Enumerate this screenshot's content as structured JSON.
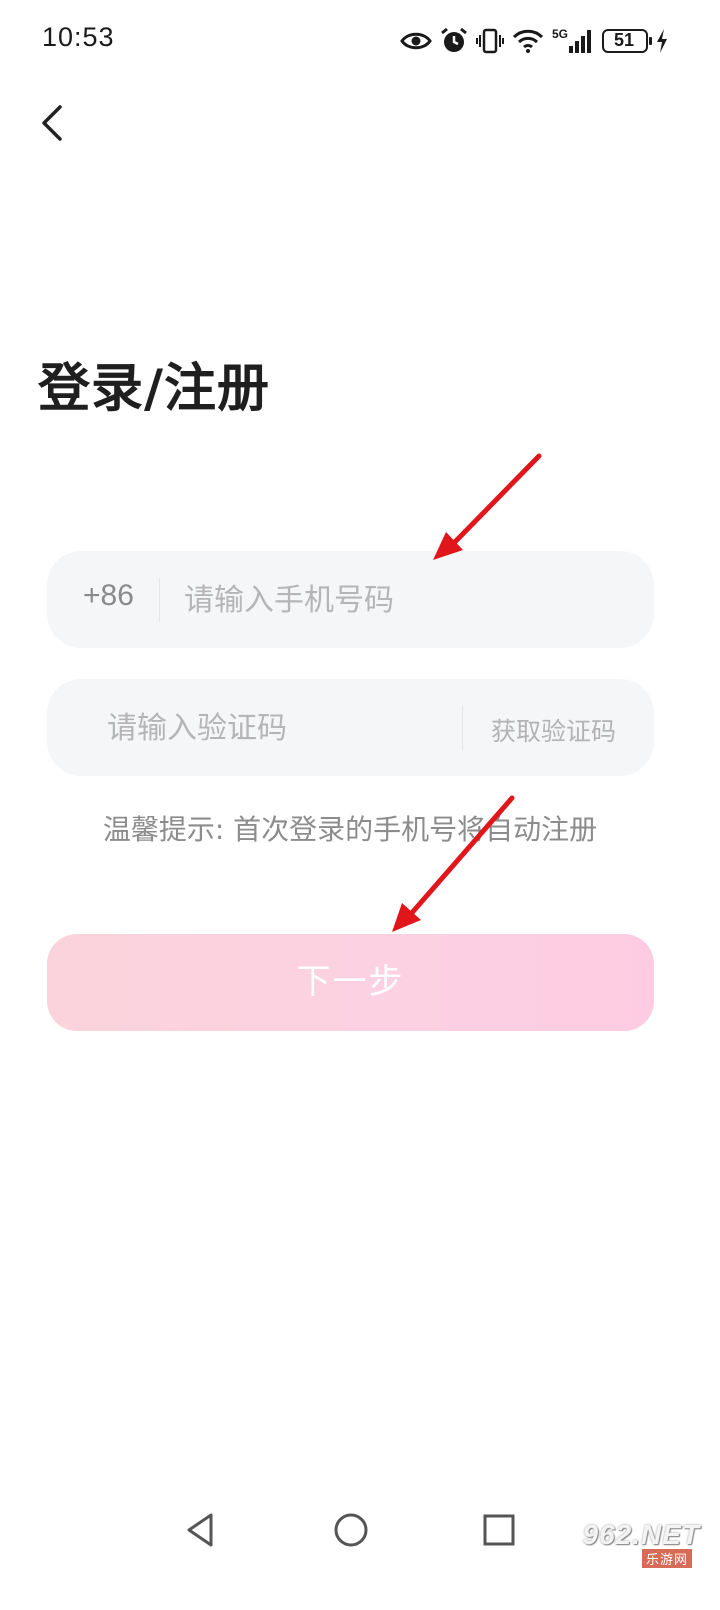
{
  "status_bar": {
    "time": "10:53",
    "network": "5G",
    "battery": "51",
    "icons": [
      "eye-icon",
      "alarm-icon",
      "vibrate-icon",
      "wifi-icon",
      "signal-icon",
      "battery-icon",
      "charging-icon"
    ]
  },
  "header": {
    "back_icon": "chevron-left-icon"
  },
  "title": "登录/注册",
  "phone_field": {
    "country_code": "+86",
    "placeholder": "请输入手机号码",
    "value": ""
  },
  "code_field": {
    "placeholder": "请输入验证码",
    "value": "",
    "get_code_label": "获取验证码"
  },
  "hint": "温馨提示: 首次登录的手机号将自动注册",
  "next_button": {
    "label": "下一步",
    "enabled": false
  },
  "annotations": {
    "arrow_color": "#e0161b"
  },
  "nav_bar": {
    "icons": [
      "back-triangle-icon",
      "home-circle-icon",
      "recents-square-icon"
    ]
  },
  "watermark": {
    "main": "962.NET",
    "sub": "乐游网"
  },
  "colors": {
    "background": "#ffffff",
    "field_background": "#f5f6f8",
    "button_pink": "#fcd2e2",
    "placeholder": "#b5b5b8",
    "title": "#1f1f1f"
  }
}
